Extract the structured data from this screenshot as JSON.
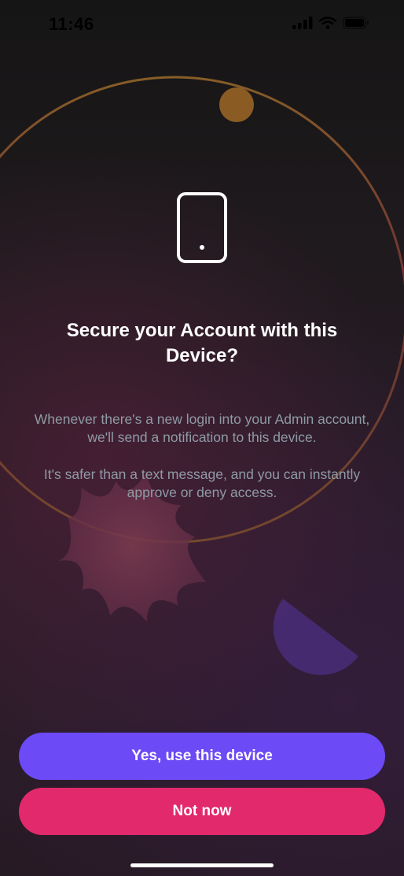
{
  "status_bar": {
    "time": "11:46",
    "icons": [
      "cellular-signal-icon",
      "wifi-icon",
      "battery-icon"
    ]
  },
  "hero": {
    "icon": "phone-device-icon",
    "title": "Secure your Account with this Device?",
    "paragraph_1": "Whenever there's a new login into your Admin account, we'll send a notification to this device.",
    "paragraph_2": "It's safer than a text message, and you can instantly approve or deny access."
  },
  "actions": {
    "primary_label": "Yes, use this device",
    "secondary_label": "Not now"
  },
  "colors": {
    "primary_button": "#6c4af5",
    "secondary_button": "#e2296c",
    "headline": "#ffffff",
    "body_text": "#8f9aa6",
    "orbit_ring": "#7a4f2e",
    "orbit_planet": "#8a5c24",
    "starburst": "#6b3349",
    "half_moon": "#4a2d7a"
  }
}
